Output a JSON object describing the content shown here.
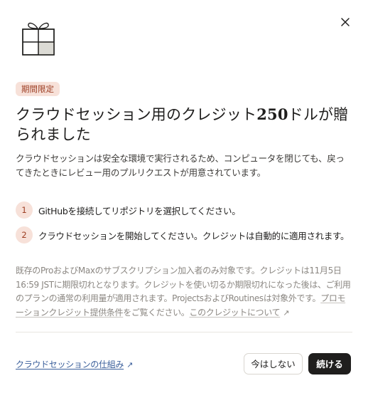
{
  "icons": {
    "close": "close-icon",
    "gift": "gift-icon",
    "external_link": "arrow-up-right-icon"
  },
  "colors": {
    "accent_bg": "#f7e1d9",
    "accent_text": "#9c3d22",
    "primary_button": "#1f1e1d"
  },
  "badge": "期間限定",
  "title": {
    "prefix": "クラウドセッション用のクレジット",
    "amount": "250",
    "suffix": "ドルが贈られました"
  },
  "description": "クラウドセッションは安全な環境で実行されるため、コンピュータを閉じても、戻ってきたときにレビュー用のプルリクエストが用意されています。",
  "steps": [
    {
      "number": "1",
      "text": "GitHubを接続してリポジトリを選択してください。"
    },
    {
      "number": "2",
      "text": "クラウドセッションを開始してください。クレジットは自動的に適用されます。"
    }
  ],
  "terms": {
    "text": "既存のProおよびMaxのサブスクリプション加入者のみ対象です。クレジットは11月5日16:59 JSTに期限切れとなります。クレジットを使い切るか期限切れになった後は、ご利用のプランの通常の利用量が適用されます。ProjectsおよびRoutinesは対象外です。",
    "promo_link": "プロモーションクレジット提供条件",
    "after_promo": "をご覧ください。",
    "about_link": "このクレジットについて"
  },
  "footer": {
    "learn_link": "クラウドセッションの仕組み",
    "secondary_button": "今はしない",
    "primary_button": "続ける"
  }
}
